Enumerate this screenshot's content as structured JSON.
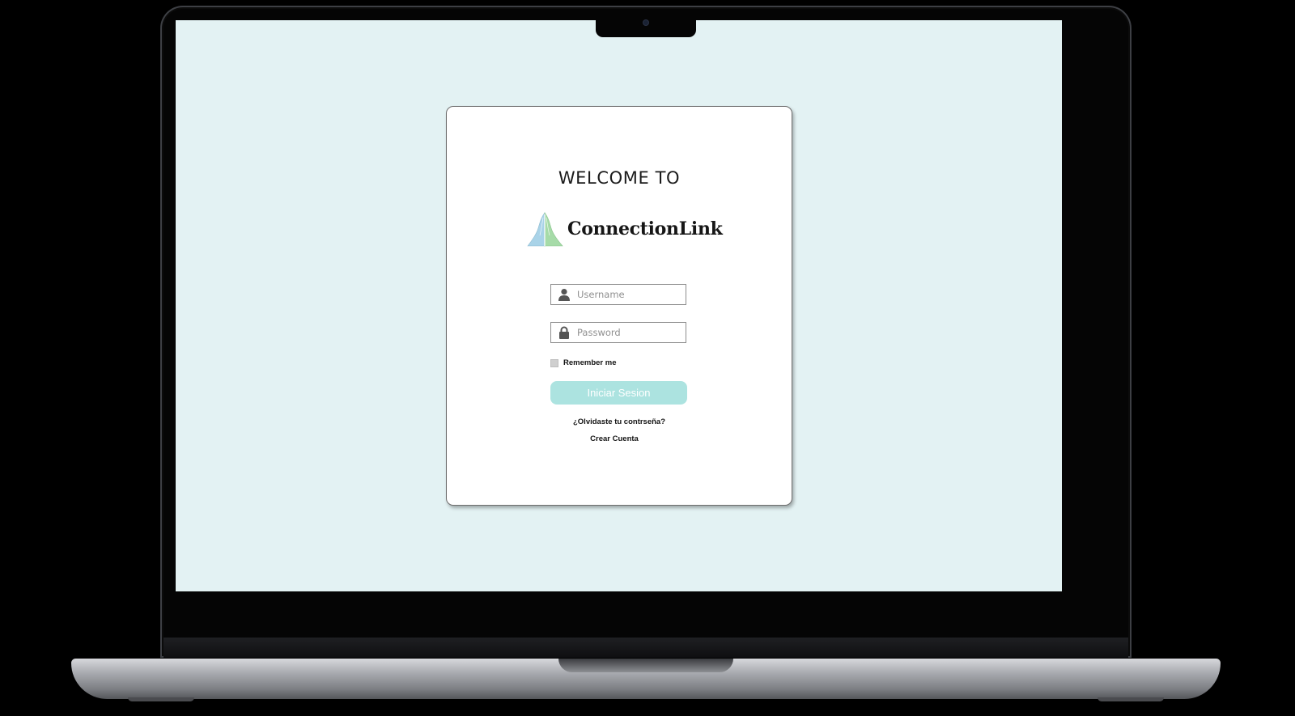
{
  "login": {
    "welcome": "WELCOME TO",
    "brand_name": "ConnectionLink",
    "username_placeholder": "Username",
    "password_placeholder": "Password",
    "remember_label": "Remember me",
    "remember_checked": false,
    "submit_label": "Iniciar Sesion",
    "forgot_link": "¿Olvidaste tu contrseña?",
    "create_link": "Crear Cuenta"
  },
  "icons": {
    "username": "user-icon",
    "password": "lock-icon",
    "brand": "praying-hands-logo"
  },
  "colors": {
    "screen_background": "#e3f2f3",
    "card_background": "#ffffff",
    "button_background": "#ace3e0",
    "button_text": "#ffffff",
    "logo_blue": "#a9d3e8",
    "logo_green": "#a6dba8"
  }
}
